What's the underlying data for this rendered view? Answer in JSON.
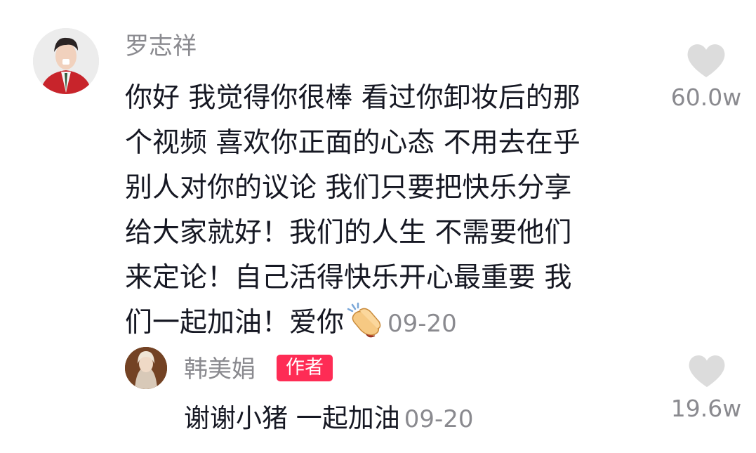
{
  "comment": {
    "username": "罗志祥",
    "lines": [
      "你好 我觉得你很棒 看过你卸妆后的那",
      "个视频 喜欢你正面的心态 不用去在乎",
      "别人对你的议论 我们只要把快乐分享",
      "给大家就好！我们的人生 不需要他们",
      "来定论！自己活得快乐开心最重要 我",
      "们一起加油！爱你"
    ],
    "emoji": "clapping-hands",
    "time": "09-20",
    "like_count": "60.0w"
  },
  "reply": {
    "username": "韩美娟",
    "badge": "作者",
    "text": "谢谢小猪 一起加油",
    "time": "09-20",
    "like_count": "19.6w"
  },
  "colors": {
    "text": "#161823",
    "secondary": "#8a8a8f",
    "badge": "#fe2c55",
    "like_icon": "#dcdcdc"
  }
}
